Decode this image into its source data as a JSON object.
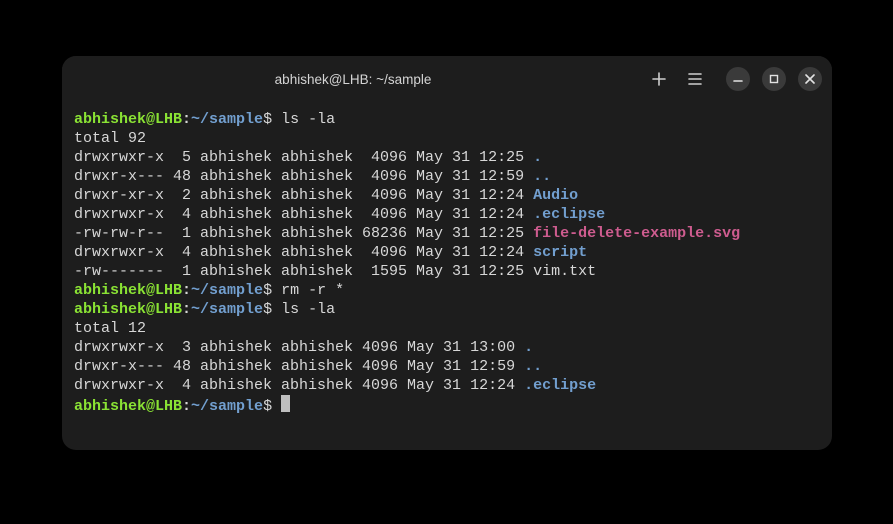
{
  "window": {
    "title": "abhishek@LHB: ~/sample"
  },
  "prompt": {
    "user_host": "abhishek@LHB",
    "colon": ":",
    "path": "~/sample",
    "dollar": "$"
  },
  "blocks": [
    {
      "command": "ls -la",
      "total": "total 92",
      "entries": [
        {
          "perm": "drwxrwxr-x",
          "links": " 5",
          "owner": "abhishek",
          "group": "abhishek",
          "size": " 4096",
          "date": "May 31 12:25",
          "name": ".",
          "color": "dir"
        },
        {
          "perm": "drwxr-x---",
          "links": "48",
          "owner": "abhishek",
          "group": "abhishek",
          "size": " 4096",
          "date": "May 31 12:59",
          "name": "..",
          "color": "dir"
        },
        {
          "perm": "drwxr-xr-x",
          "links": " 2",
          "owner": "abhishek",
          "group": "abhishek",
          "size": " 4096",
          "date": "May 31 12:24",
          "name": "Audio",
          "color": "dir"
        },
        {
          "perm": "drwxrwxr-x",
          "links": " 4",
          "owner": "abhishek",
          "group": "abhishek",
          "size": " 4096",
          "date": "May 31 12:24",
          "name": ".eclipse",
          "color": "dir"
        },
        {
          "perm": "-rw-rw-r--",
          "links": " 1",
          "owner": "abhishek",
          "group": "abhishek",
          "size": "68236",
          "date": "May 31 12:25",
          "name": "file-delete-example.svg",
          "color": "pink"
        },
        {
          "perm": "drwxrwxr-x",
          "links": " 4",
          "owner": "abhishek",
          "group": "abhishek",
          "size": " 4096",
          "date": "May 31 12:24",
          "name": "script",
          "color": "dir"
        },
        {
          "perm": "-rw-------",
          "links": " 1",
          "owner": "abhishek",
          "group": "abhishek",
          "size": " 1595",
          "date": "May 31 12:25",
          "name": "vim.txt",
          "color": "file"
        }
      ]
    },
    {
      "command": "rm -r *"
    },
    {
      "command": "ls -la",
      "total": "total 12",
      "entries": [
        {
          "perm": "drwxrwxr-x",
          "links": " 3",
          "owner": "abhishek",
          "group": "abhishek",
          "size": "4096",
          "date": "May 31 13:00",
          "name": ".",
          "color": "dir"
        },
        {
          "perm": "drwxr-x---",
          "links": "48",
          "owner": "abhishek",
          "group": "abhishek",
          "size": "4096",
          "date": "May 31 12:59",
          "name": "..",
          "color": "dir"
        },
        {
          "perm": "drwxrwxr-x",
          "links": " 4",
          "owner": "abhishek",
          "group": "abhishek",
          "size": "4096",
          "date": "May 31 12:24",
          "name": ".eclipse",
          "color": "dir"
        }
      ]
    },
    {
      "command": "",
      "cursor": true
    }
  ]
}
